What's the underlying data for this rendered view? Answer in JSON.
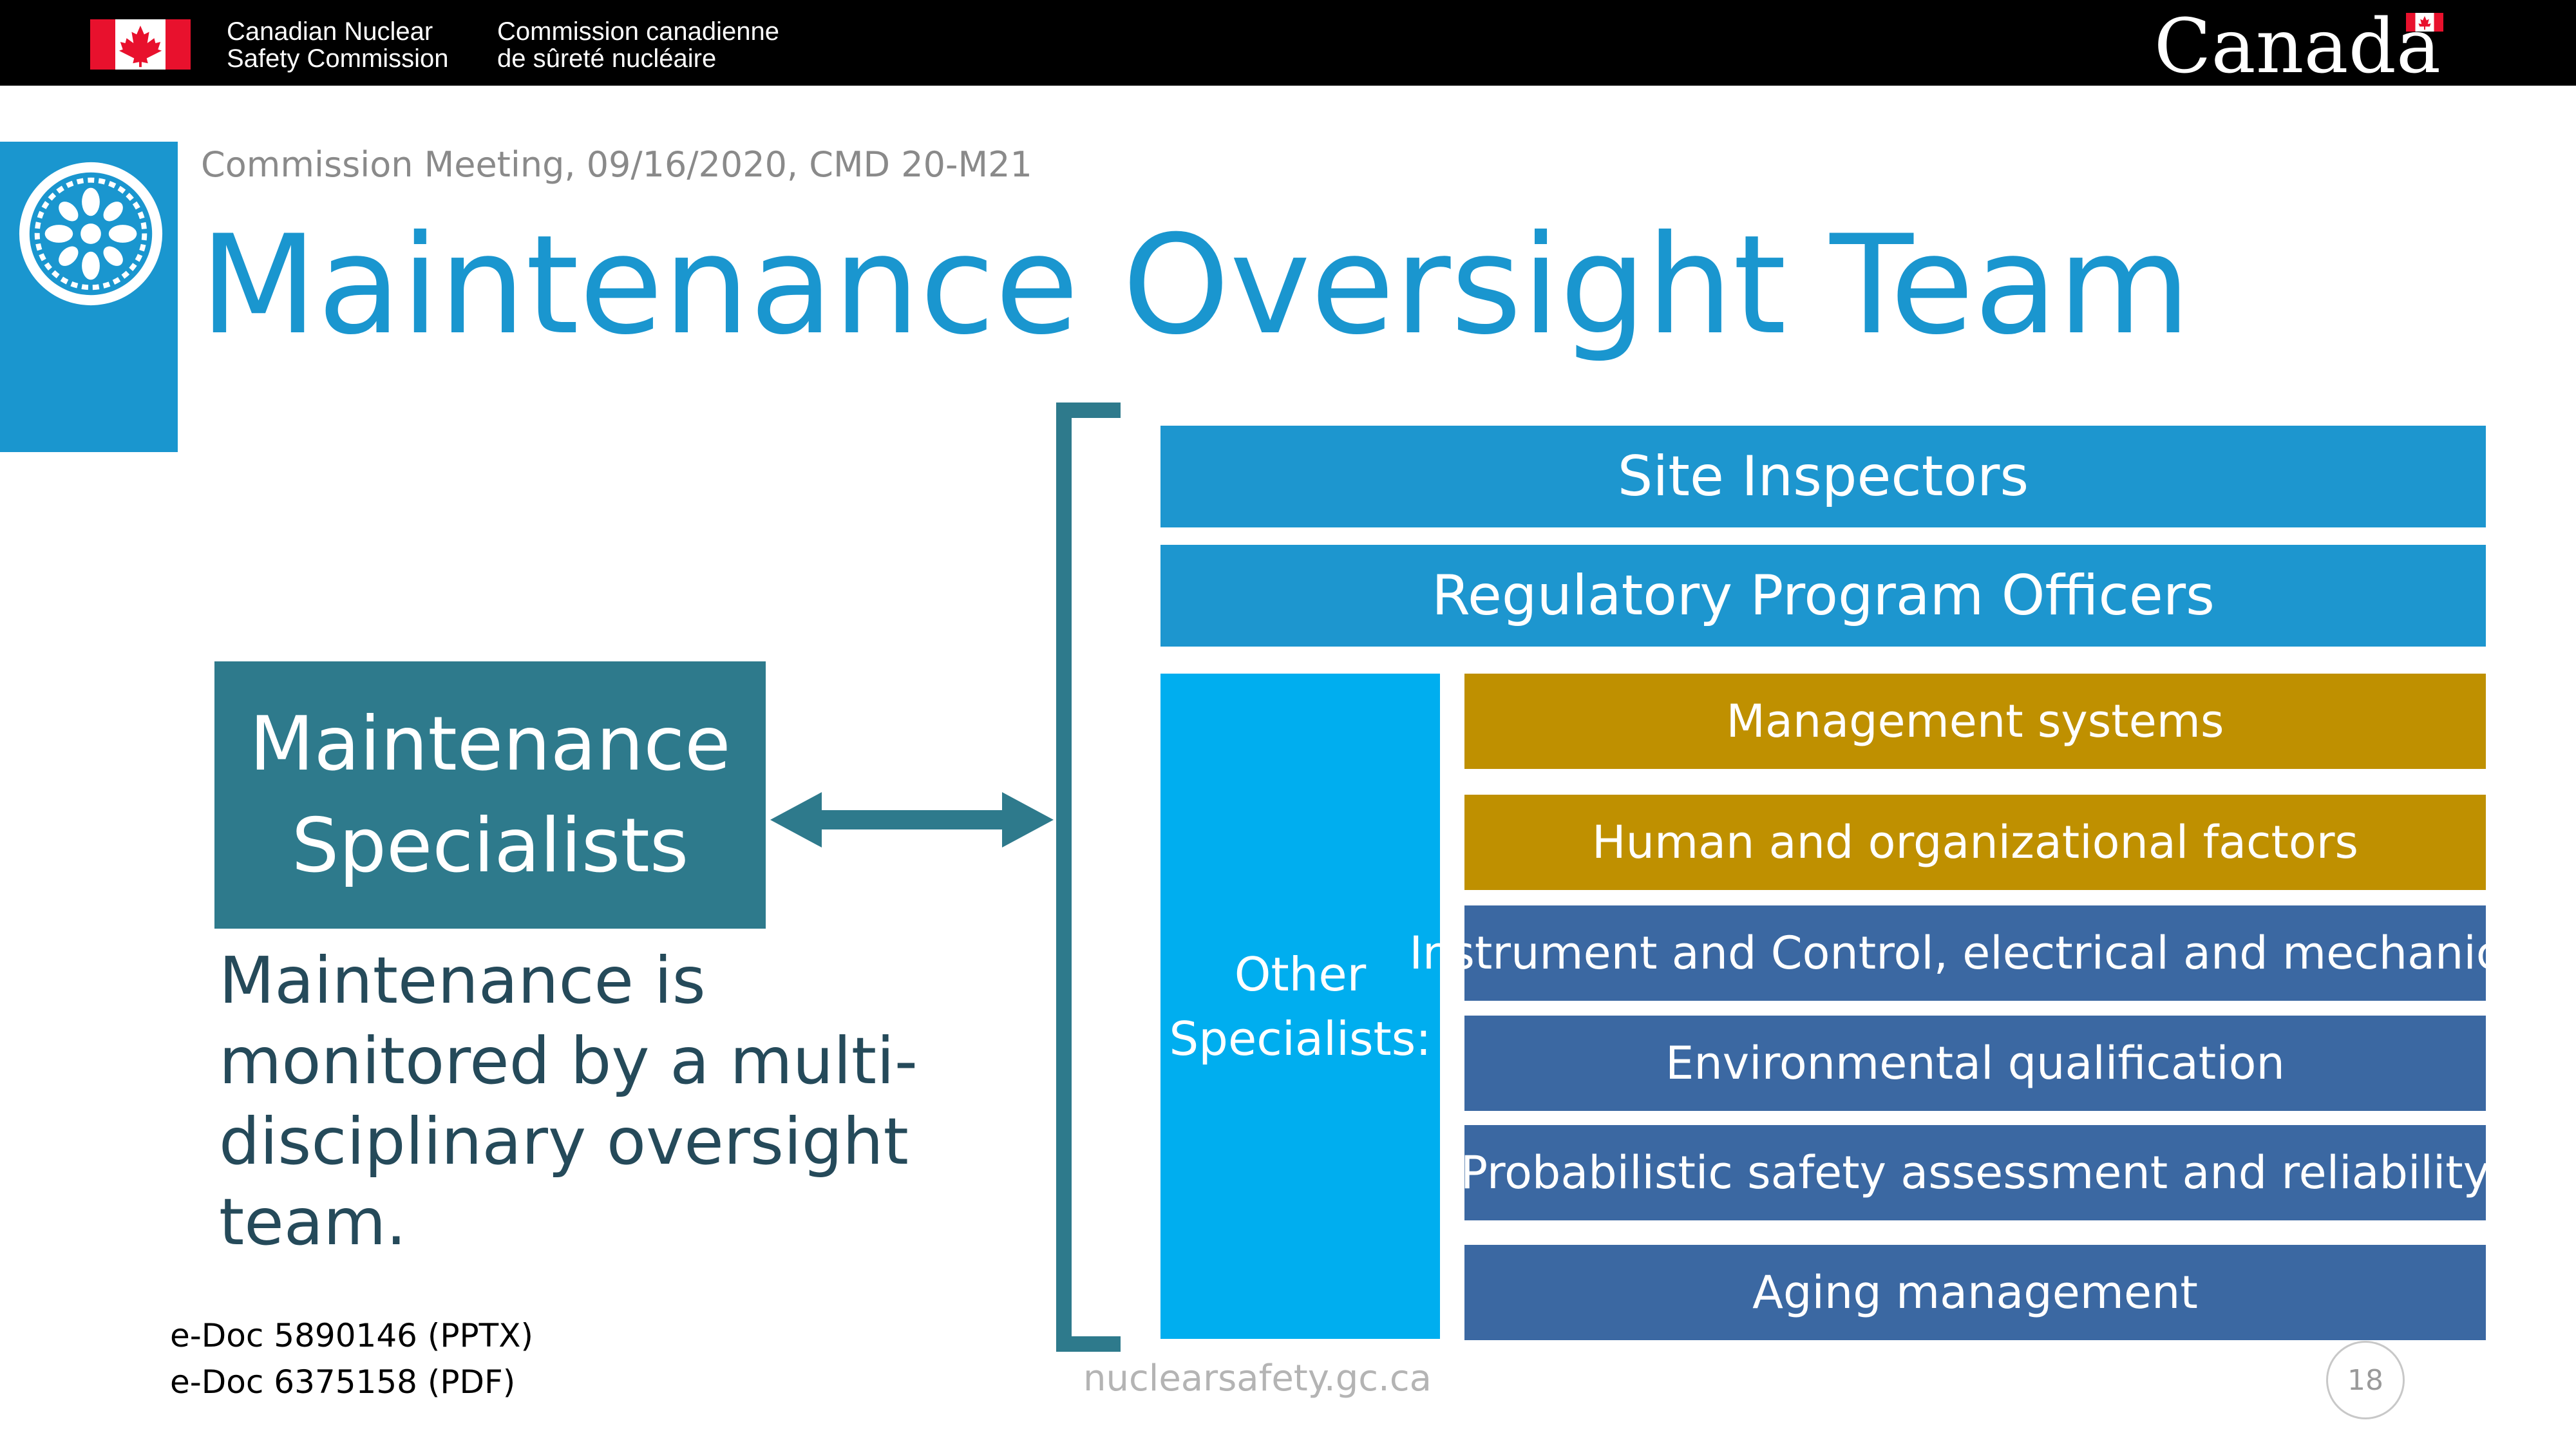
{
  "header": {
    "org_name_en": "Canadian Nuclear\nSafety Commission",
    "org_name_fr": "Commission canadienne\nde sûreté nucléaire",
    "wordmark": "Canada",
    "colors": {
      "bar": "#000000",
      "flag_red": "#e8112d"
    }
  },
  "slide": {
    "meeting_line": "Commission Meeting, 09/16/2020, CMD 20-M21",
    "title": "Maintenance Oversight Team",
    "maintenance_box": "Maintenance\nSpecialists",
    "description": "Maintenance is monitored by a multi-disciplinary oversight team.",
    "site_inspectors": "Site Inspectors",
    "regulatory_program_officers": "Regulatory Program Officers",
    "other_specialists_label": "Other\nSpecialists:",
    "specialists": [
      "Management systems",
      "Human and organizational factors",
      "Instrument and Control, electrical and mechanical",
      "Environmental qualification",
      "Probabilistic safety assessment and reliability",
      "Aging management"
    ],
    "colors": {
      "title": "#1a96cf",
      "teal": "#2e7a8c",
      "blue": "#1d96cf",
      "cyan": "#00aeef",
      "gold": "#bf9000",
      "steel": "#3b68a2"
    }
  },
  "footer": {
    "edoc_pptx": "e-Doc 5890146 (PPTX)",
    "edoc_pdf": "e-Doc 6375158 (PDF)",
    "website": "nuclearsafety.gc.ca",
    "page_number": "18"
  },
  "icons": [
    "canada-flag-icon",
    "cnsc-emblem-icon",
    "double-arrow-icon",
    "bracket-icon"
  ]
}
